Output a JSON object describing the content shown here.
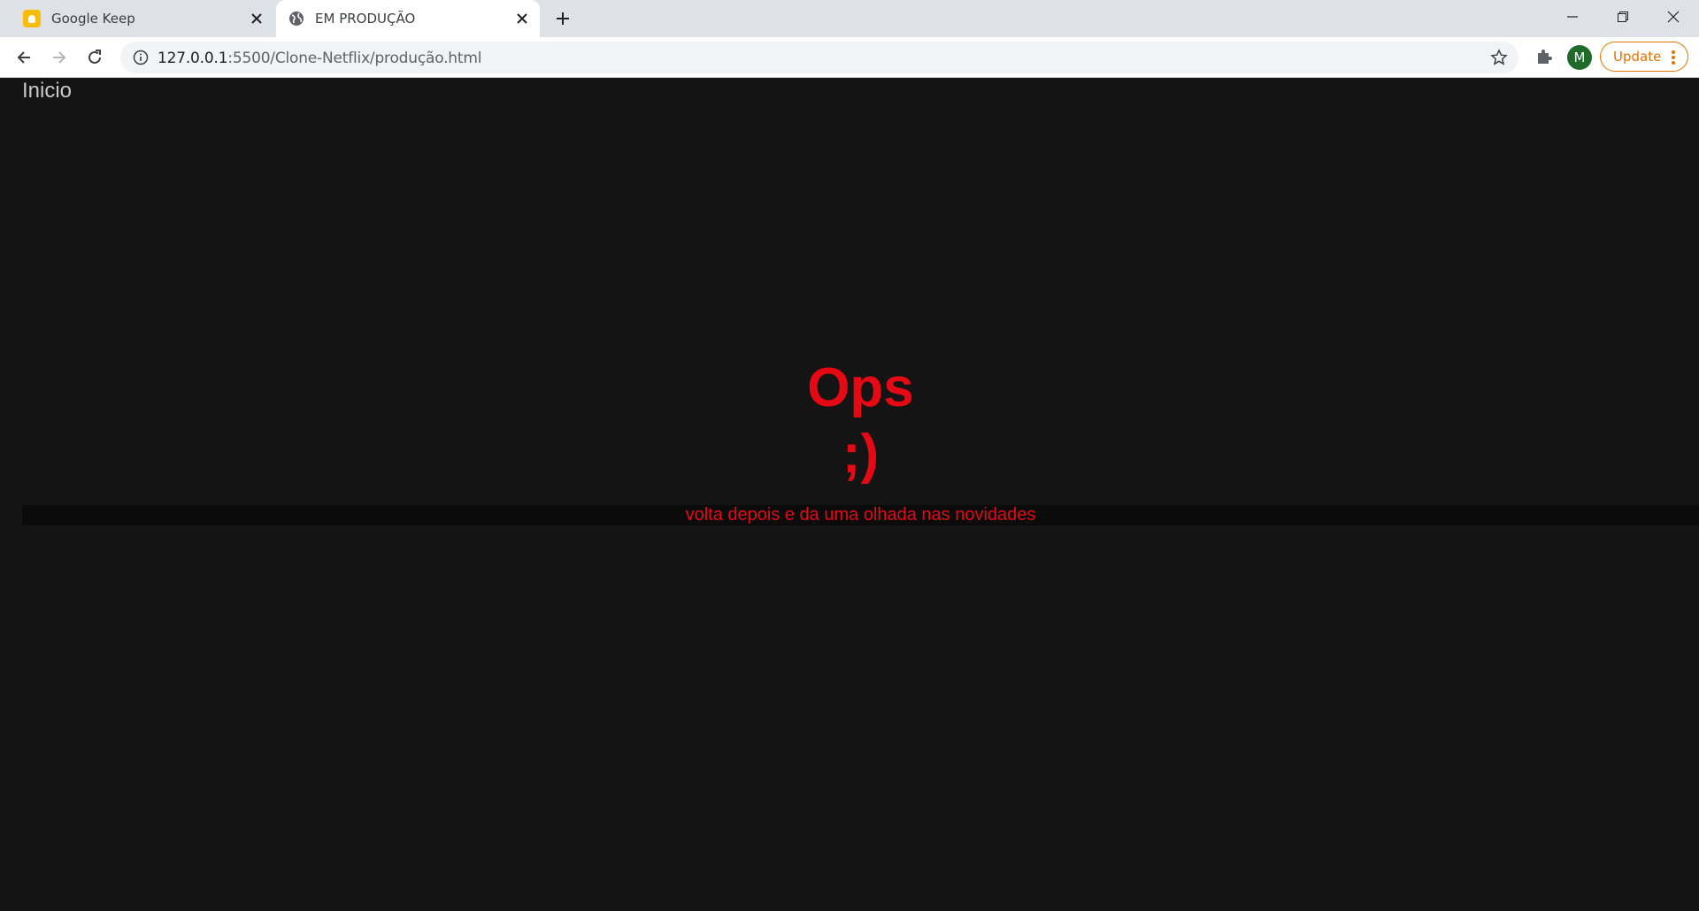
{
  "browser": {
    "tabs": [
      {
        "title": "Google Keep",
        "icon": "google-keep-icon",
        "active": false
      },
      {
        "title": "EM PRODUÇÃO",
        "icon": "globe-icon",
        "active": true
      }
    ],
    "url_host": "127.0.0.1",
    "url_path": ":5500/Clone-Netflix/produção.html",
    "profile_initial": "M",
    "update_label": "Update",
    "accent_update": "#e37400",
    "avatar_color": "#1e6b2c"
  },
  "page": {
    "home_link": "Inicio",
    "heading": "Ops",
    "subheading": ";)",
    "message": "volta depois e da uma olhada nas novidades",
    "background": "#141414",
    "accent": "#e50914"
  }
}
